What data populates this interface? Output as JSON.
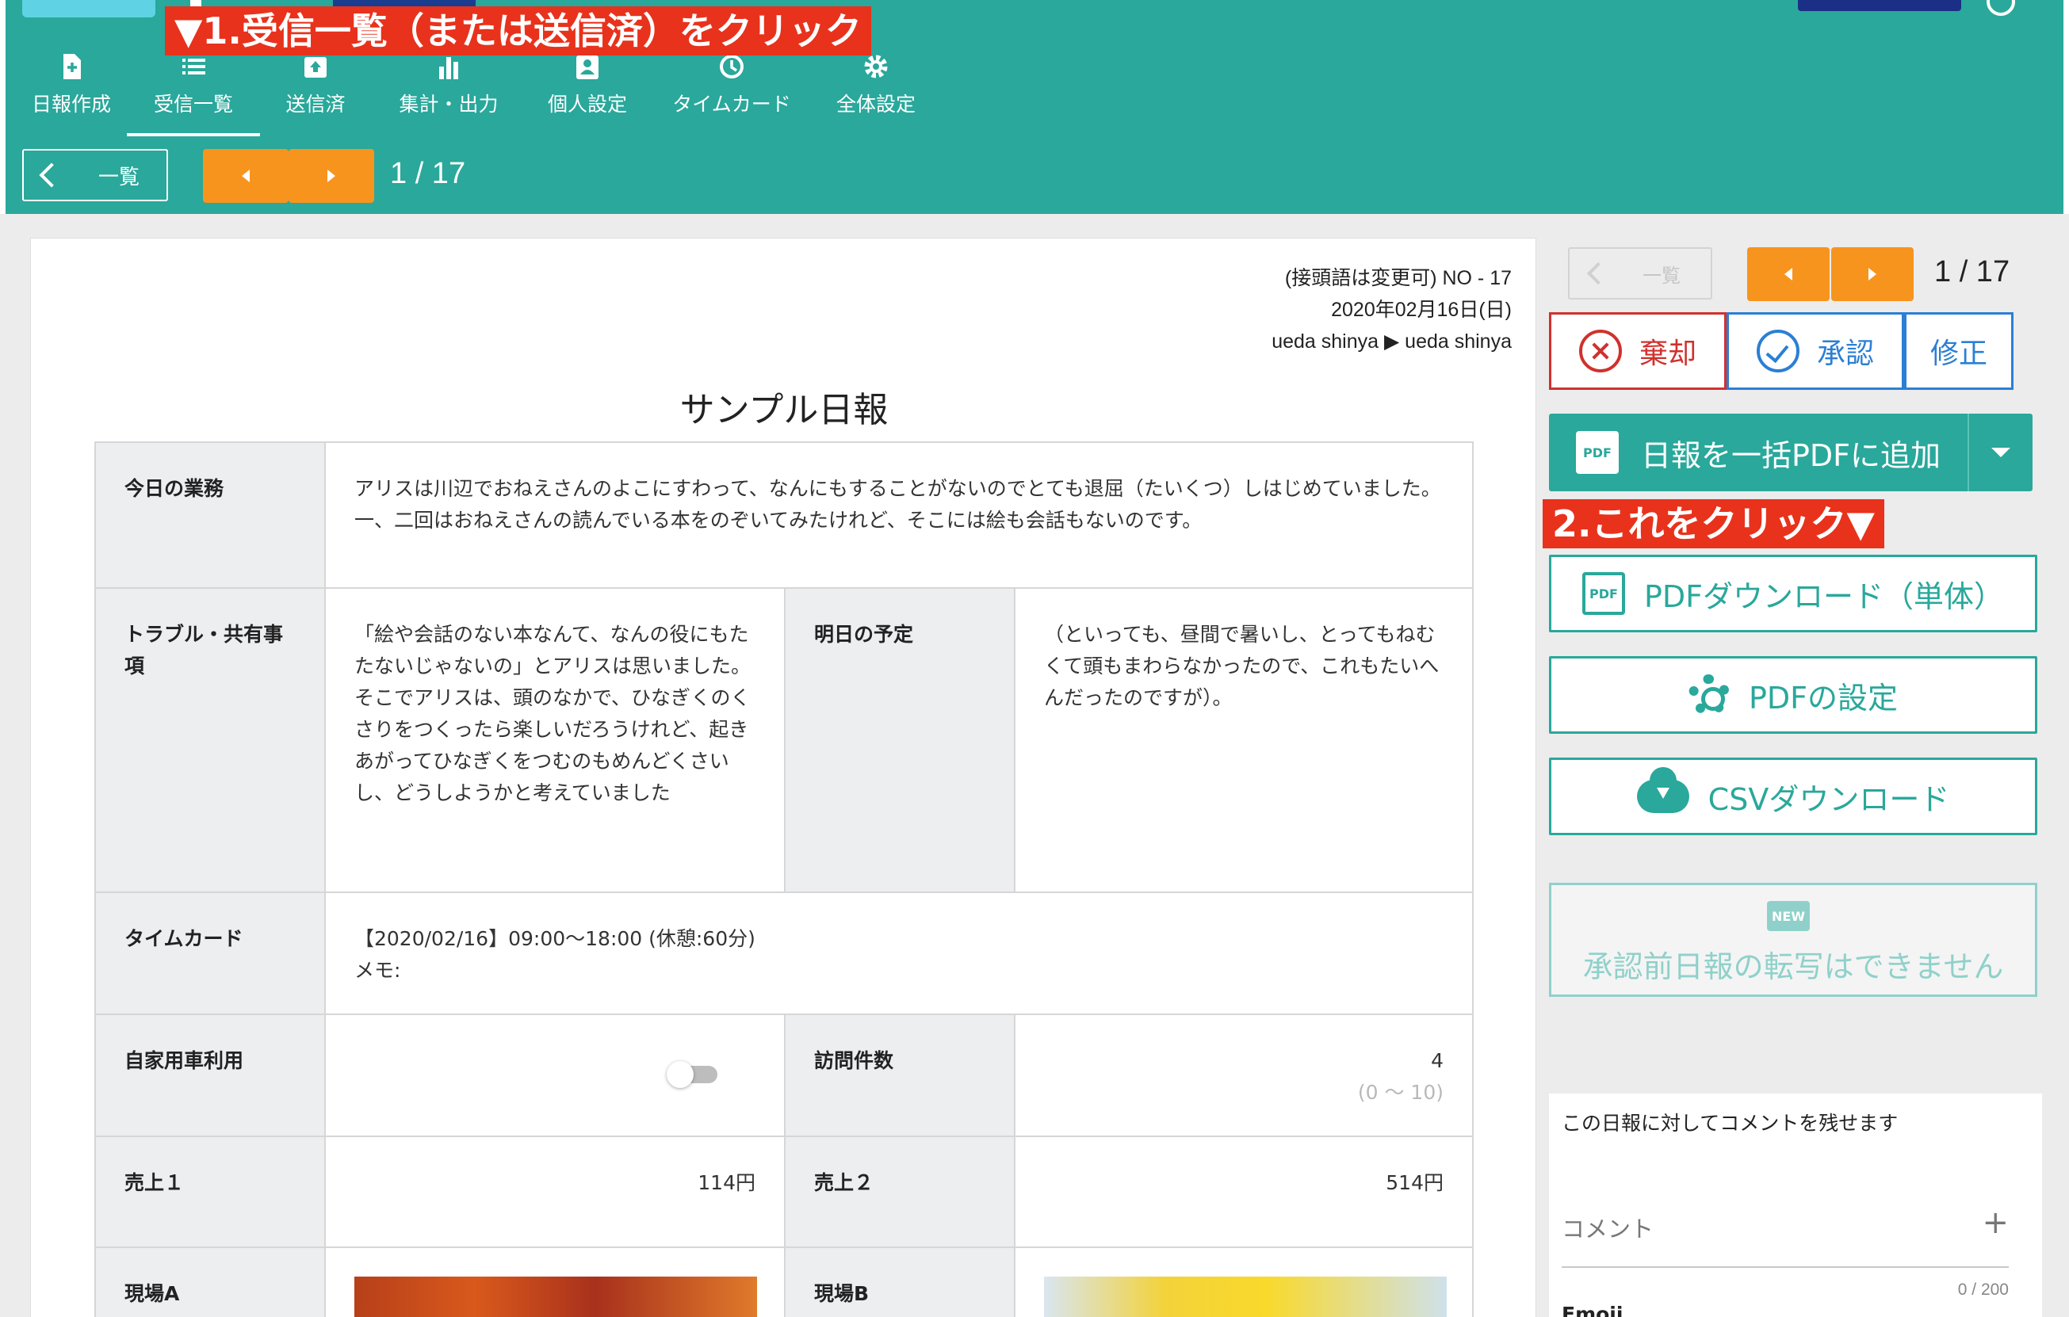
{
  "annotations": {
    "step1": "▼1.受信一覧（または送信済）をクリック",
    "step2": "2.これをクリック▼"
  },
  "nav": {
    "items": [
      {
        "label": "日報作成",
        "icon": "file-plus-icon"
      },
      {
        "label": "受信一覧",
        "icon": "list-icon",
        "active": true
      },
      {
        "label": "送信済",
        "icon": "upload-tray-icon"
      },
      {
        "label": "集計・出力",
        "icon": "bar-chart-icon"
      },
      {
        "label": "個人設定",
        "icon": "user-card-icon"
      },
      {
        "label": "タイムカード",
        "icon": "clock-icon"
      },
      {
        "label": "全体設定",
        "icon": "gear-icon"
      }
    ]
  },
  "pager": {
    "back_label": "一覧",
    "count": "1 / 17"
  },
  "report": {
    "meta": {
      "number": "(接頭語は変更可) NO - 17",
      "date": "2020年02月16日(日)",
      "route": "ueda shinya ▶ ueda shinya"
    },
    "title": "サンプル日報",
    "fields": {
      "today_label": "今日の業務",
      "today_value": "アリスは川辺でおねえさんのよこにすわって、なんにもすることがないのでとても退屈（たいくつ）しはじめていました。一、二回はおねえさんの読んでいる本をのぞいてみたけれど、そこには絵も会話もないのです。",
      "trouble_label": "トラブル・共有事項",
      "trouble_value": "「絵や会話のない本なんて、なんの役にもたたないじゃないの」とアリスは思いました。そこでアリスは、頭のなかで、ひなぎくのくさりをつくったら楽しいだろうけれど、起きあがってひなぎくをつむのもめんどくさいし、どうしようかと考えていました",
      "tomorrow_label": "明日の予定",
      "tomorrow_value": "（といっても、昼間で暑いし、とってもねむくて頭もまわらなかったので、これもたいへんだったのですが）。",
      "timecard_label": "タイムカード",
      "timecard_line1": "【2020/02/16】09:00〜18:00 (休憩:60分)",
      "timecard_line2": "メモ:",
      "car_label": "自家用車利用",
      "car_on": false,
      "visits_label": "訪問件数",
      "visits_value": "4",
      "visits_range": "(0 〜 10)",
      "sales1_label": "売上１",
      "sales1_value": "114円",
      "sales2_label": "売上２",
      "sales2_value": "514円",
      "siteA_label": "現場A",
      "siteB_label": "現場B"
    }
  },
  "sidebar": {
    "back_label": "一覧",
    "count": "1 / 17",
    "reject_label": "棄却",
    "approve_label": "承認",
    "fix_label": "修正",
    "pdf_bulk_label": "日報を一括PDFに追加",
    "pdf_download_label": "PDFダウンロード（単体）",
    "pdf_settings_label": "PDFの設定",
    "csv_download_label": "CSVダウンロード",
    "new_badge": "NEW",
    "transcribe_label": "承認前日報の転写はできません",
    "pdf_icon_text": "PDF",
    "comment": {
      "hint": "この日報に対してコメントを残せます",
      "label": "コメント",
      "counter": "0 / 200",
      "emoji_label": "Emoji"
    }
  },
  "colors": {
    "header": "#29a89b",
    "accent_orange": "#f7941e",
    "annotation_red": "#e8321c",
    "reject_red": "#d0312d",
    "approve_blue": "#2b7fd4"
  }
}
